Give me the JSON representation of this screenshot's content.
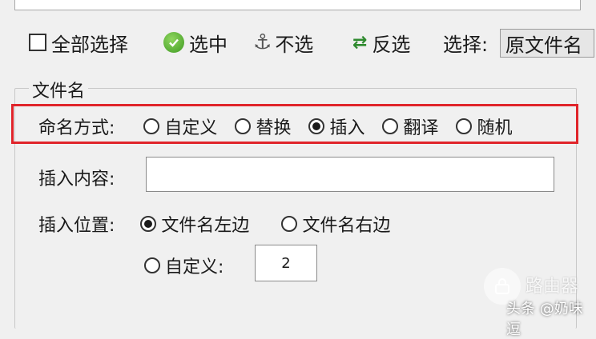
{
  "toolbar": {
    "select_all_label": "全部选择",
    "select_label": "选中",
    "deselect_label": "不选",
    "invert_label": "反选",
    "choose_label": "选择:",
    "choose_value": "原文件名"
  },
  "group": {
    "title": "文件名"
  },
  "naming": {
    "label": "命名方式:",
    "options": [
      "自定义",
      "替换",
      "插入",
      "翻译",
      "随机"
    ],
    "selected": "插入"
  },
  "insert_content": {
    "label": "插入内容:",
    "value": ""
  },
  "insert_position": {
    "label": "插入位置:",
    "options": [
      "文件名左边",
      "文件名右边",
      "自定义:"
    ],
    "selected": "文件名左边",
    "custom_value": "2"
  },
  "watermark": {
    "logo_text": "路由器",
    "credit": "头条 @奶味逗"
  },
  "colors": {
    "highlight_frame": "#e0242a",
    "background": "#f0f0f0"
  }
}
